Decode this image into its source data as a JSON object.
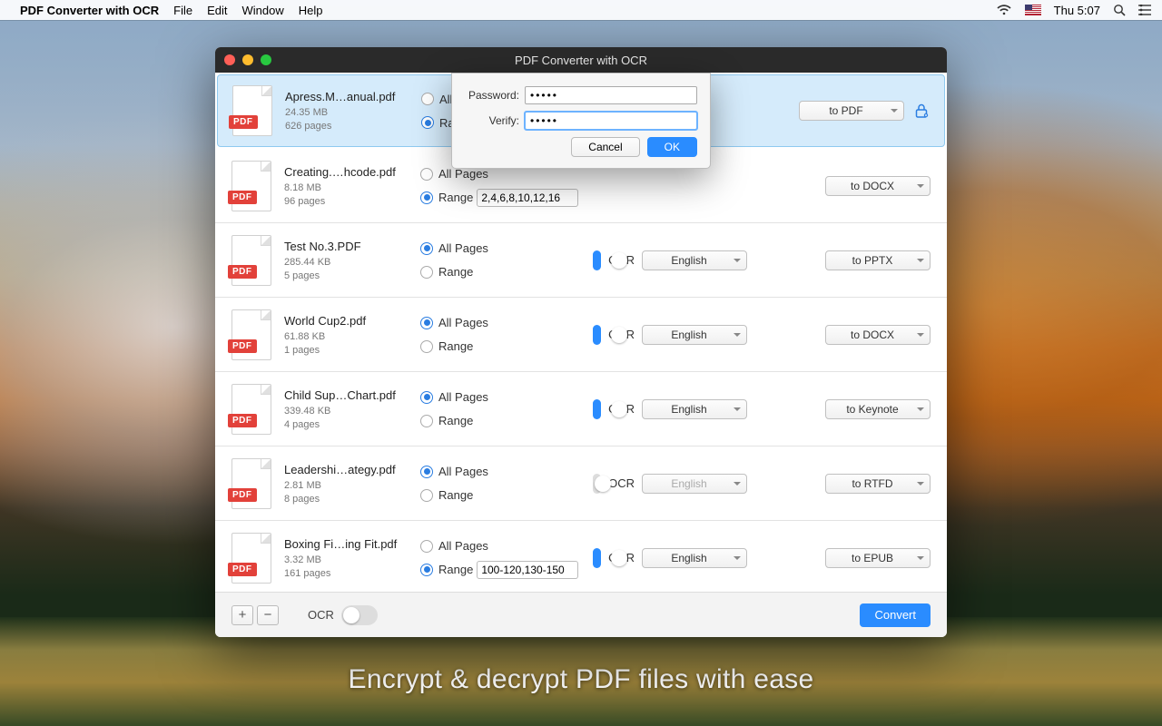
{
  "menubar": {
    "app_name": "PDF Converter with OCR",
    "items": [
      "File",
      "Edit",
      "Window",
      "Help"
    ],
    "clock": "Thu 5:07"
  },
  "window": {
    "title": "PDF Converter with OCR"
  },
  "common": {
    "all_pages": "All Pages",
    "range": "Range",
    "ocr": "OCR",
    "pdf_badge": "PDF"
  },
  "files": [
    {
      "name": "Apress.M…anual.pdf",
      "size": "24.35 MB",
      "pages": "626 pages",
      "selected": true,
      "page_mode": "range",
      "range_value": "",
      "ocr_on": false,
      "show_ocr": false,
      "lang": "",
      "format": "to PDF",
      "show_lock": true
    },
    {
      "name": "Creating.…hcode.pdf",
      "size": "8.18 MB",
      "pages": "96 pages",
      "selected": false,
      "page_mode": "range",
      "range_value": "2,4,6,8,10,12,16",
      "ocr_on": false,
      "show_ocr": false,
      "lang": "",
      "format": "to DOCX",
      "show_lock": false
    },
    {
      "name": "Test No.3.PDF",
      "size": "285.44 KB",
      "pages": "5 pages",
      "selected": false,
      "page_mode": "all",
      "range_value": "",
      "ocr_on": true,
      "show_ocr": true,
      "lang": "English",
      "format": "to PPTX",
      "show_lock": false
    },
    {
      "name": "World Cup2.pdf",
      "size": "61.88 KB",
      "pages": "1 pages",
      "selected": false,
      "page_mode": "all",
      "range_value": "",
      "ocr_on": true,
      "show_ocr": true,
      "lang": "English",
      "format": "to DOCX",
      "show_lock": false
    },
    {
      "name": "Child Sup…Chart.pdf",
      "size": "339.48 KB",
      "pages": "4 pages",
      "selected": false,
      "page_mode": "all",
      "range_value": "",
      "ocr_on": true,
      "show_ocr": true,
      "lang": "English",
      "format": "to Keynote",
      "show_lock": false
    },
    {
      "name": "Leadershi…ategy.pdf",
      "size": "2.81 MB",
      "pages": "8 pages",
      "selected": false,
      "page_mode": "all",
      "range_value": "",
      "ocr_on": false,
      "show_ocr": true,
      "lang": "English",
      "format": "to RTFD",
      "show_lock": false
    },
    {
      "name": "Boxing Fi…ing Fit.pdf",
      "size": "3.32 MB",
      "pages": "161 pages",
      "selected": false,
      "page_mode": "range",
      "range_value": "100-120,130-150",
      "ocr_on": true,
      "show_ocr": true,
      "lang": "English",
      "format": "to EPUB",
      "show_lock": false
    }
  ],
  "bottombar": {
    "ocr_label": "OCR",
    "convert": "Convert"
  },
  "dialog": {
    "password_label": "Password:",
    "verify_label": "Verify:",
    "password_value": "•••••",
    "verify_value": "•••••",
    "cancel": "Cancel",
    "ok": "OK"
  },
  "tagline": "Encrypt & decrypt PDF files with ease"
}
